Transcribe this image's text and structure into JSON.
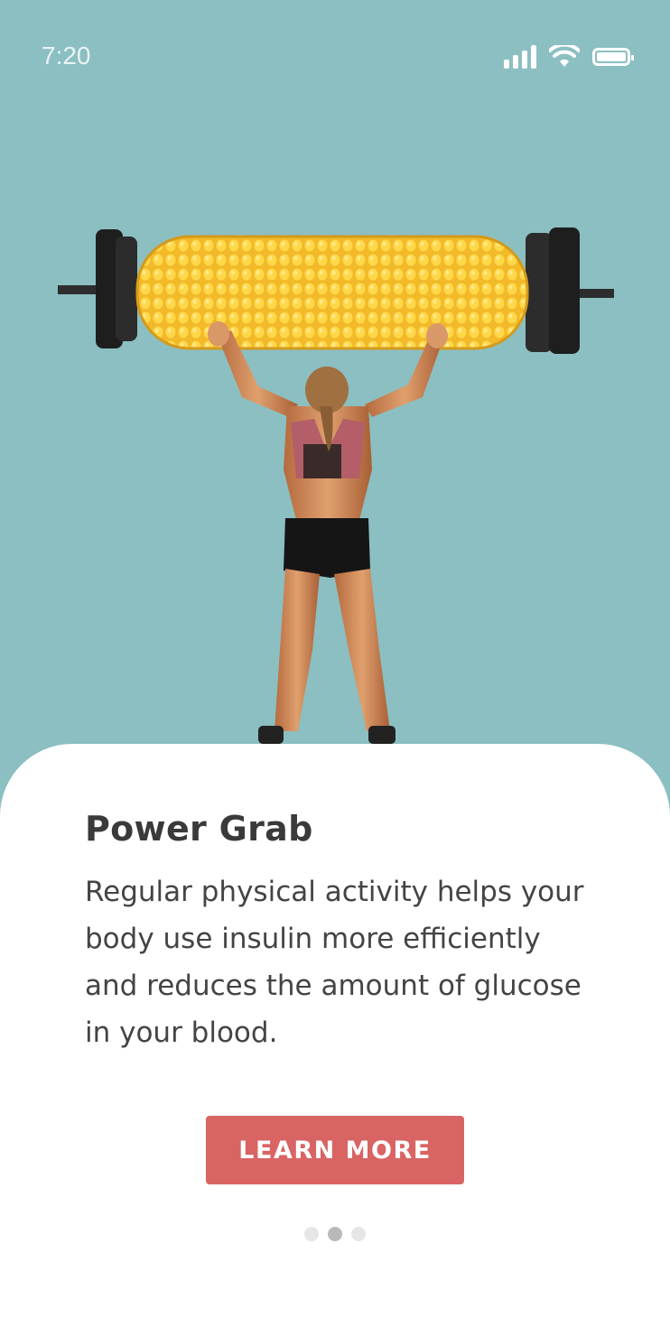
{
  "status_bar": {
    "time": "7:20",
    "icons": [
      "signal-icon",
      "wifi-icon",
      "battery-icon"
    ],
    "color": "#ffffff"
  },
  "hero": {
    "description_icon": "corn-barbell-weightlifter-illustration",
    "background_color": "#8bbfc2"
  },
  "card": {
    "title": "Power Grab",
    "body": "Regular physical activity helps your body use insulin more efficiently and reduces the amount of glucose in your blood.",
    "button_label": "LEARN MORE",
    "button_color": "#d96464"
  },
  "pagination": {
    "total": 3,
    "active_index": 1
  }
}
